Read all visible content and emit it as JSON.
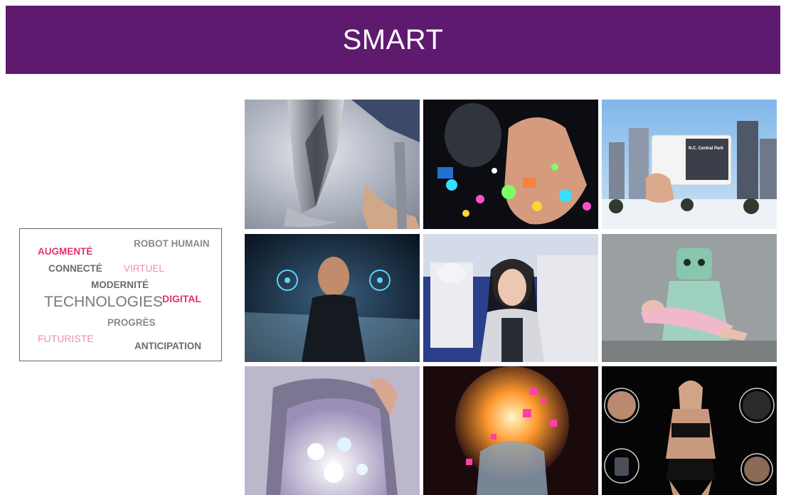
{
  "banner": {
    "title": "SMART"
  },
  "word_cloud": {
    "words": {
      "robot_humain": "ROBOT HUMAIN",
      "augmente": "AUGMENTÉ",
      "connecte": "CONNECTÉ",
      "virtuel": "VIRTUEL",
      "modernite": "MODERNITÉ",
      "technologies": "TECHNOLOGIES",
      "digital": "DIGITAL",
      "progres": "PROGRÈS",
      "futuriste": "FUTURISTE",
      "anticipation": "ANTICIPATION"
    }
  },
  "colors": {
    "banner_bg": "#5e1a6e",
    "accent_pink": "#e4316e",
    "light_pink": "#eb8fb4",
    "gray_text": "#6b6b6b"
  },
  "photos": [
    {
      "id": "prosthetic-leg-photo"
    },
    {
      "id": "holographic-hand-photo"
    },
    {
      "id": "ar-card-central-park-photo",
      "card_title": "N.C. Central Park",
      "card_text": "The N.C. New York, Central Park is a Greenbelt Sanctuary in the heart of the City"
    },
    {
      "id": "gesture-interface-photo"
    },
    {
      "id": "humanoid-robots-photo"
    },
    {
      "id": "care-robot-photo"
    },
    {
      "id": "led-dress-photo"
    },
    {
      "id": "digital-head-photo"
    },
    {
      "id": "wearable-sensors-photo"
    }
  ]
}
